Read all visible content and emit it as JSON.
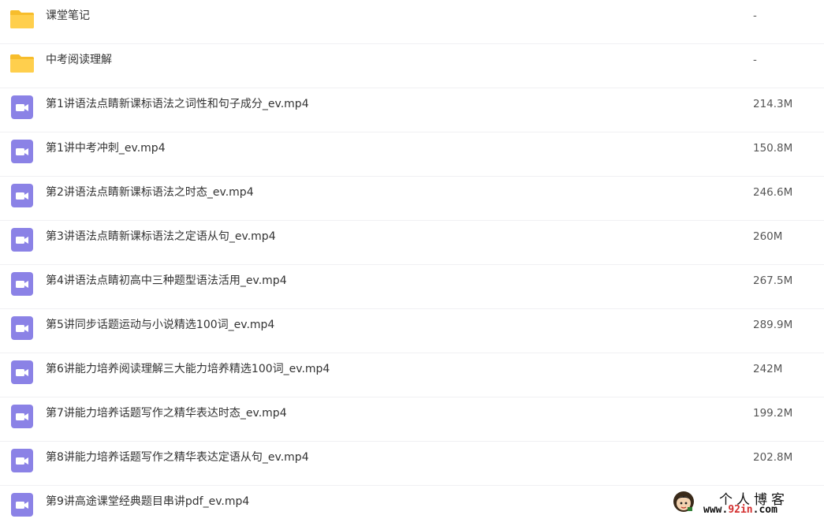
{
  "files": [
    {
      "name": "课堂笔记",
      "size": "-",
      "type": "folder",
      "icon": "folder-icon"
    },
    {
      "name": "中考阅读理解",
      "size": "-",
      "type": "folder",
      "icon": "folder-icon"
    },
    {
      "name": "第1讲语法点睛新课标语法之词性和句子成分_ev.mp4",
      "size": "214.3M",
      "type": "video",
      "icon": "video-file-icon"
    },
    {
      "name": "第1讲中考冲刺_ev.mp4",
      "size": "150.8M",
      "type": "video",
      "icon": "video-file-icon"
    },
    {
      "name": "第2讲语法点睛新课标语法之时态_ev.mp4",
      "size": "246.6M",
      "type": "video",
      "icon": "video-file-icon"
    },
    {
      "name": "第3讲语法点睛新课标语法之定语从句_ev.mp4",
      "size": "260M",
      "type": "video",
      "icon": "video-file-icon"
    },
    {
      "name": "第4讲语法点睛初高中三种题型语法活用_ev.mp4",
      "size": "267.5M",
      "type": "video",
      "icon": "video-file-icon"
    },
    {
      "name": "第5讲同步话题运动与小说精选100词_ev.mp4",
      "size": "289.9M",
      "type": "video",
      "icon": "video-file-icon"
    },
    {
      "name": "第6讲能力培养阅读理解三大能力培养精选100词_ev.mp4",
      "size": "242M",
      "type": "video",
      "icon": "video-file-icon"
    },
    {
      "name": "第7讲能力培养话题写作之精华表达时态_ev.mp4",
      "size": "199.2M",
      "type": "video",
      "icon": "video-file-icon"
    },
    {
      "name": "第8讲能力培养话题写作之精华表达定语从句_ev.mp4",
      "size": "202.8M",
      "type": "video",
      "icon": "video-file-icon"
    },
    {
      "name": "第9讲高途课堂经典题目串讲pdf_ev.mp4",
      "size": "",
      "type": "video",
      "icon": "video-file-icon"
    }
  ],
  "watermark": {
    "title": "个人博客",
    "url_prefix": "www.",
    "url_accent": "92in",
    "url_suffix": ".com",
    "icon": "avatar-logo"
  },
  "colors": {
    "folder": "#ffcf4d",
    "folder_back": "#f7bd2c",
    "video": "#8b82e6",
    "divider": "#f0f0f3"
  }
}
